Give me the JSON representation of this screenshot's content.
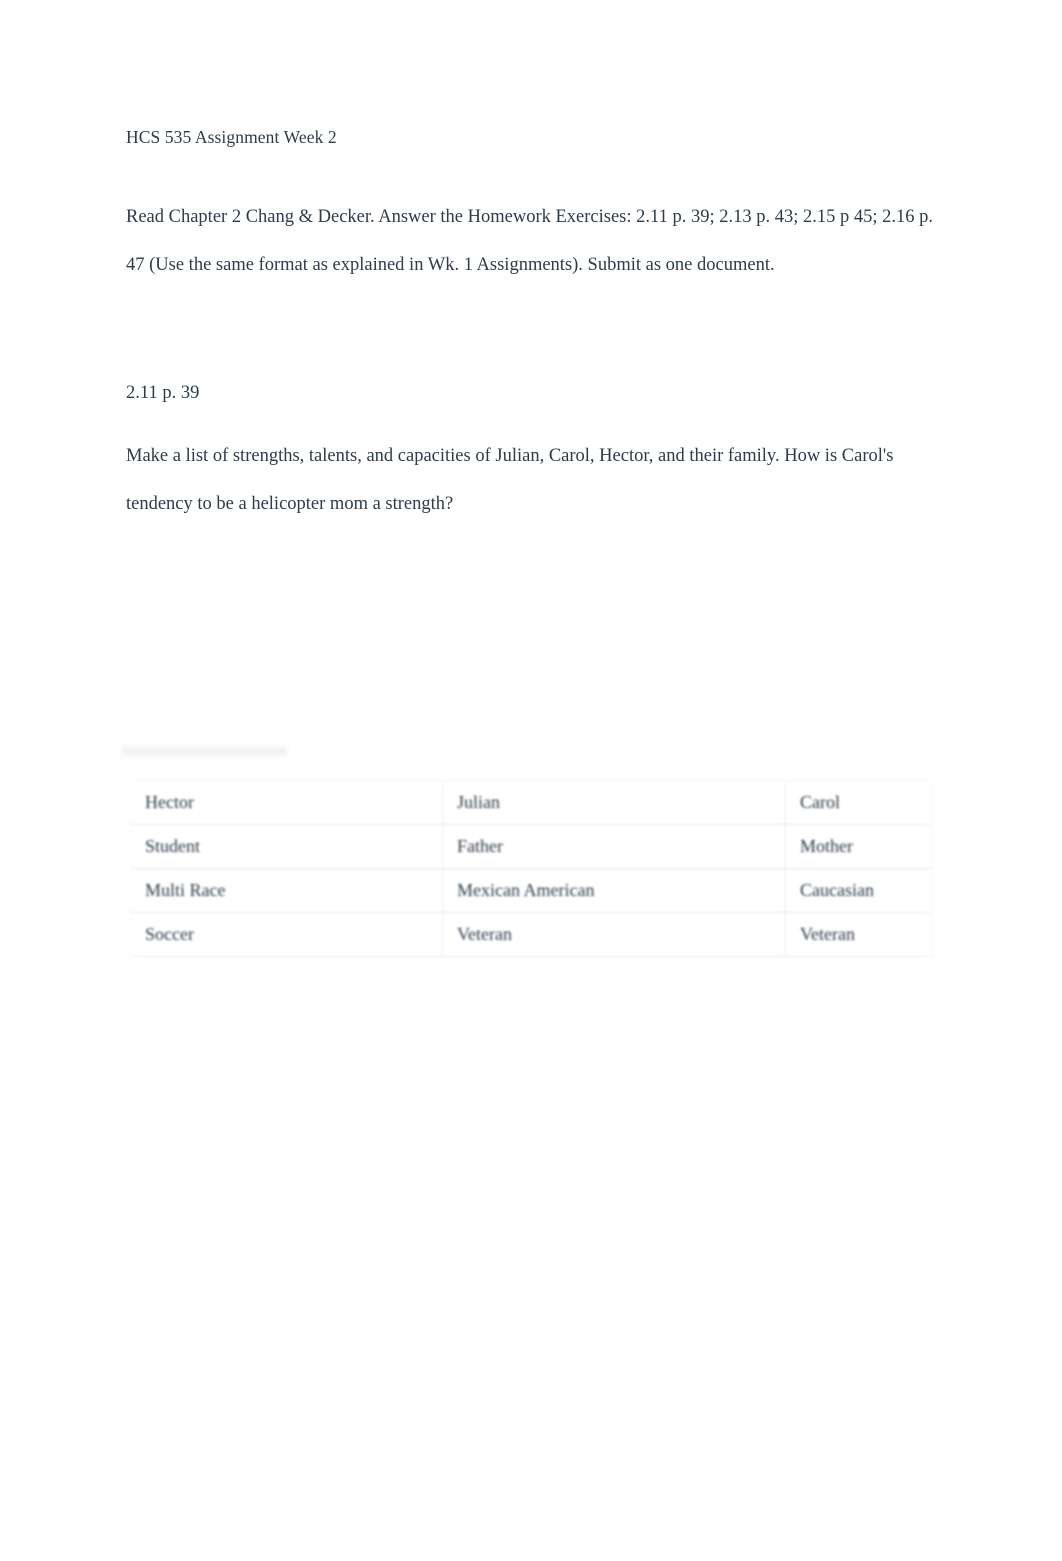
{
  "document": {
    "title": "HCS 535 Assignment Week 2",
    "intro_paragraph": "Read Chapter 2 Chang & Decker. Answer the  Homework Exercises: 2.11 p. 39; 2.13 p. 43; 2.15 p 45; 2.16 p. 47 (Use the same format as explained in Wk. 1 Assignments). Submit as one document.",
    "exercise_number": "2.11 p. 39",
    "question": "Make a list of strengths, talents, and capacities of Julian, Carol, Hector, and their family. How is Carol's tendency to be a helicopter mom a strength?"
  },
  "table": {
    "rows": [
      {
        "col1": "Hector",
        "col2": "Julian",
        "col3": "Carol"
      },
      {
        "col1": "Student",
        "col2": "Father",
        "col3": "Mother"
      },
      {
        "col1": "Multi Race",
        "col2": "Mexican American",
        "col3": "Caucasian"
      },
      {
        "col1": "Soccer",
        "col2": "Veteran",
        "col3": "Veteran"
      }
    ]
  },
  "colors": {
    "text": "#2d3b4a",
    "page_background": "#ffffff",
    "table_border": "#e4e5e7"
  }
}
